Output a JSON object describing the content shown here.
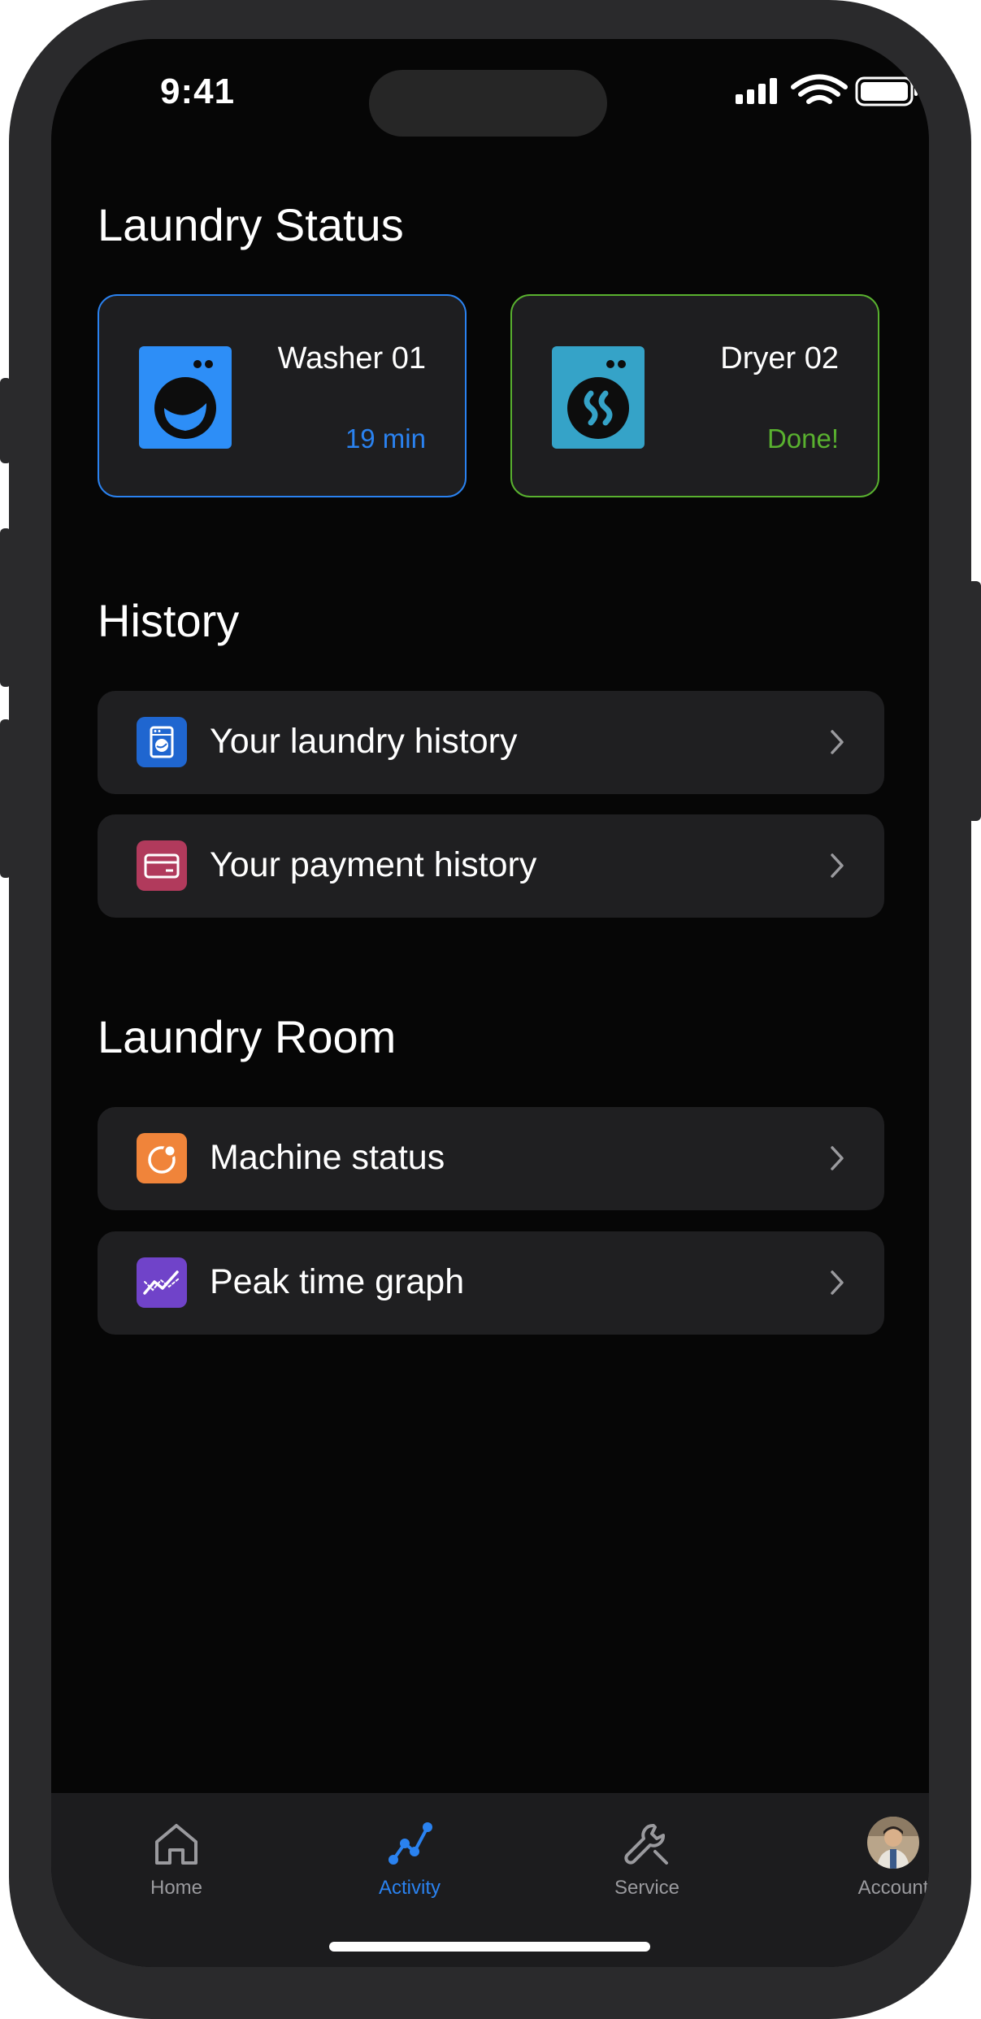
{
  "status_bar": {
    "time": "9:41"
  },
  "sections": {
    "laundry_status": "Laundry Status",
    "history": "History",
    "laundry_room": "Laundry Room"
  },
  "machines": [
    {
      "name": "Washer 01",
      "status": "19 min",
      "icon": "washer-icon",
      "accent": "#2a82f0",
      "icon_bg": "#2d8ef7"
    },
    {
      "name": "Dryer 02",
      "status": "Done!",
      "icon": "dryer-icon",
      "accent": "#59b12f",
      "icon_bg": "#35a3c8"
    }
  ],
  "history_items": [
    {
      "label": "Your laundry history",
      "icon": "washing-machine-icon",
      "icon_bg": "#1f66d0"
    },
    {
      "label": "Your payment history",
      "icon": "credit-card-icon",
      "icon_bg": "#b13a5c"
    }
  ],
  "room_items": [
    {
      "label": "Machine status",
      "icon": "status-icon",
      "icon_bg": "#f0843a"
    },
    {
      "label": "Peak time graph",
      "icon": "graph-icon",
      "icon_bg": "#7043c9"
    }
  ],
  "tabs": [
    {
      "label": "Home",
      "icon": "home-icon",
      "active": false
    },
    {
      "label": "Activity",
      "icon": "activity-icon",
      "active": true
    },
    {
      "label": "Service",
      "icon": "wrench-icon",
      "active": false
    },
    {
      "label": "Account",
      "icon": "avatar",
      "active": false
    }
  ],
  "colors": {
    "background": "#060606",
    "card": "#1f1f21",
    "active_tab": "#2a82f0",
    "inactive_tab": "#9a9a9e",
    "chevron": "#9a9a9e"
  }
}
